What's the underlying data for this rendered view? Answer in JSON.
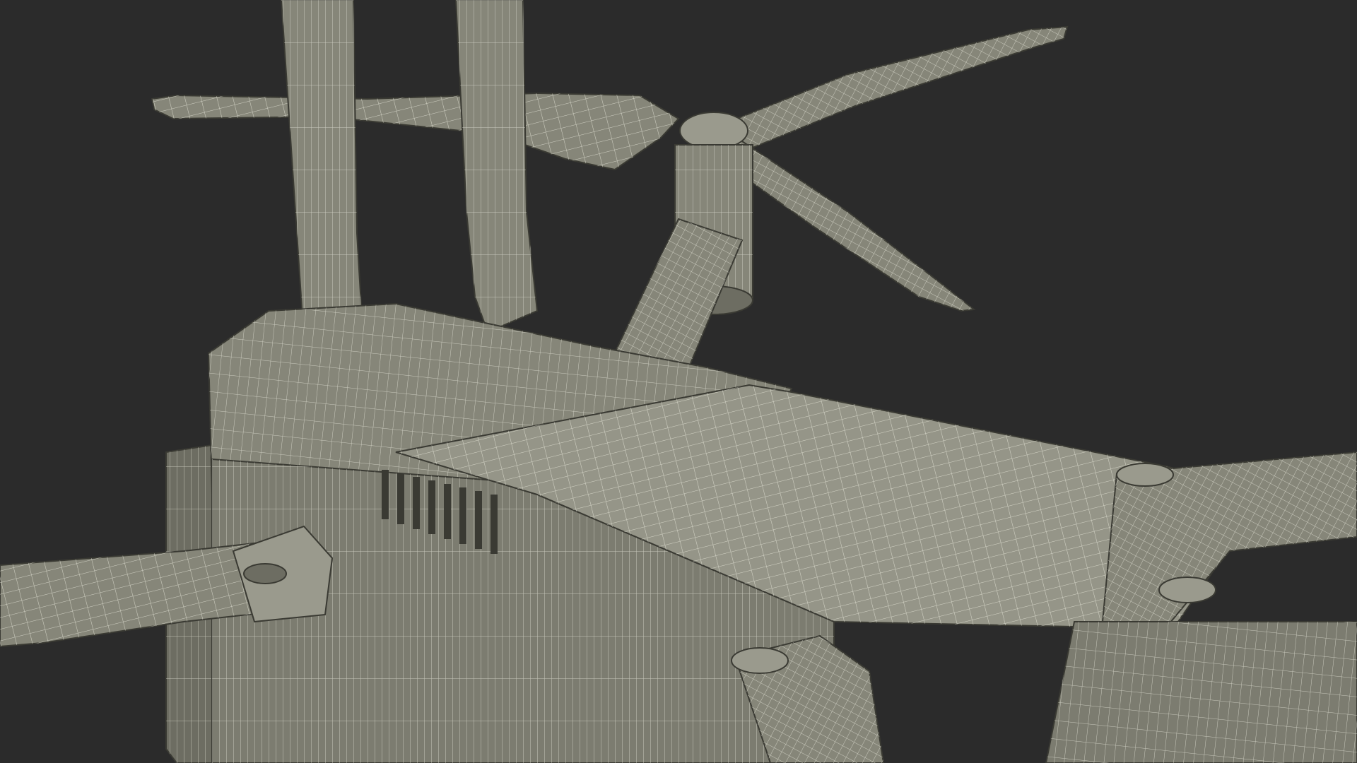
{
  "scene": {
    "subject": "drone-wireframe-model",
    "colors": {
      "background": "#2b2b2b",
      "surface": "#868679",
      "surface_light": "#9a9a8d",
      "surface_dark": "#6d6d62",
      "wire": "#e9e9dc",
      "edge": "#3a3a33"
    }
  }
}
